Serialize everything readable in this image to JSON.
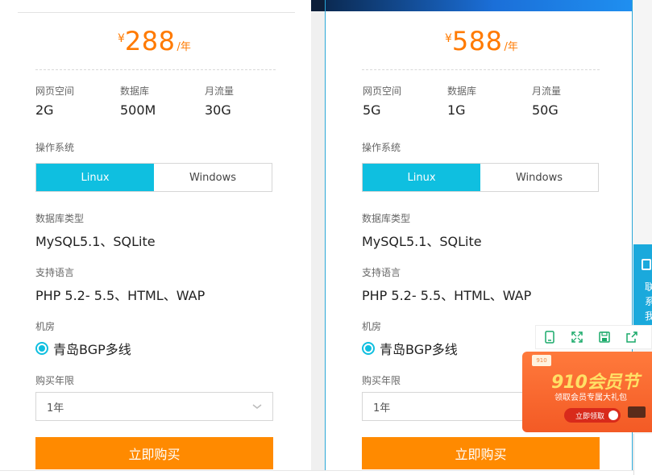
{
  "plans": [
    {
      "price": {
        "currency": "¥",
        "amount": "288",
        "unit": "/年"
      },
      "specs": [
        {
          "label": "网页空间",
          "value": "2G"
        },
        {
          "label": "数据库",
          "value": "500M"
        },
        {
          "label": "月流量",
          "value": "30G"
        }
      ],
      "os_label": "操作系统",
      "os_options": [
        "Linux",
        "Windows"
      ],
      "os_selected": "Linux",
      "db_type_label": "数据库类型",
      "db_type_value": "MySQL5.1、SQLite",
      "lang_label": "支持语言",
      "lang_value": "PHP 5.2- 5.5、HTML、WAP",
      "room_label": "机房",
      "room_value": "青岛BGP多线",
      "term_label": "购买年限",
      "term_value": "1年",
      "buy_label": "立即购买"
    },
    {
      "price": {
        "currency": "¥",
        "amount": "588",
        "unit": "/年"
      },
      "specs": [
        {
          "label": "网页空间",
          "value": "5G"
        },
        {
          "label": "数据库",
          "value": "1G"
        },
        {
          "label": "月流量",
          "value": "50G"
        }
      ],
      "os_label": "操作系统",
      "os_options": [
        "Linux",
        "Windows"
      ],
      "os_selected": "Linux",
      "db_type_label": "数据库类型",
      "db_type_value": "MySQL5.1、SQLite",
      "lang_label": "支持语言",
      "lang_value": "PHP 5.2- 5.5、HTML、WAP",
      "room_label": "机房",
      "room_value": "青岛BGP多线",
      "term_label": "购买年限",
      "term_value": "1年",
      "buy_label": "立即购买"
    }
  ],
  "side_tab": {
    "text": "联系我"
  },
  "toolbar_icons": [
    "phone-icon",
    "fullscreen-icon",
    "save-icon",
    "share-icon"
  ],
  "promo": {
    "tag": "910",
    "title": "910会员节",
    "subtitle": "领取会员专属大礼包",
    "cta": "立即领取"
  },
  "colors": {
    "accent": "#0fbfe0",
    "price": "#ff7a00",
    "buy": "#ff8a00",
    "promo": "#f35a25"
  }
}
